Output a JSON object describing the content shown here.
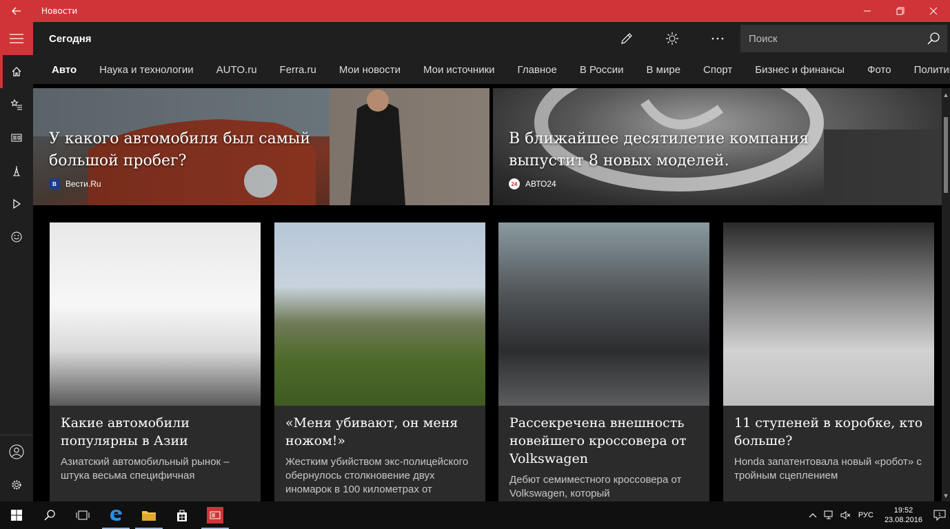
{
  "window": {
    "title": "Новости",
    "back_icon": "back-arrow-icon"
  },
  "header": {
    "title": "Сегодня",
    "search_placeholder": "Поиск"
  },
  "tabs": [
    "Авто",
    "Наука и технологии",
    "AUTO.ru",
    "Ferra.ru",
    "Мои новости",
    "Мои источники",
    "Главное",
    "В России",
    "В мире",
    "Спорт",
    "Бизнес и финансы",
    "Фото",
    "Политика"
  ],
  "active_tab": "Авто",
  "hero": [
    {
      "headline": "У какого автомобиля был самый большой пробег?",
      "source": "Вести.Ru",
      "logo_text": "В"
    },
    {
      "headline": "В ближайшее десятилетие компания выпустит 8 новых моделей.",
      "source": "АВТО24",
      "logo_text": "24"
    }
  ],
  "cards": [
    {
      "title": "Какие автомобили популярны в Азии",
      "desc": "Азиатский автомобильный рынок – штука весьма специфичная"
    },
    {
      "title": "«Меня убивают, он меня ножом!»",
      "desc": "Жестким убийством экс-полицейского обернулось столкновение двух иномарок в 100 километрах от"
    },
    {
      "title": "Рассекречена внешность новейшего кроссовера от Volkswagen",
      "desc": "Дебют семиместного кроссовера от Volkswagen, который"
    },
    {
      "title": "11 ступеней в коробке, кто больше?",
      "desc": "Honda запатентовала новый «робот» с тройным сцеплением"
    }
  ],
  "taskbar": {
    "language": "РУС",
    "time": "19:52",
    "date": "23.08.2016",
    "notification_count": "1"
  },
  "colors": {
    "accent": "#d13438",
    "chrome": "#1f1f1f",
    "card": "#2b2b2b"
  }
}
